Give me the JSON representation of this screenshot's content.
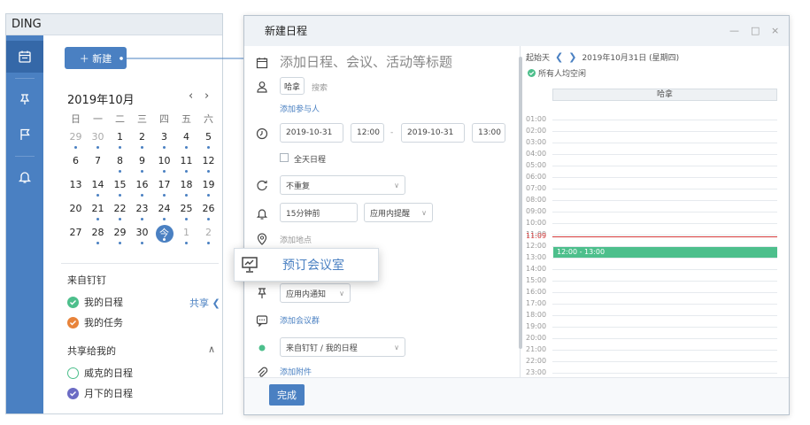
{
  "app": {
    "title": "DING",
    "new_button": "＋ 新建",
    "calendar": {
      "month_title": "2019年10月",
      "prev": "‹",
      "next": "›",
      "weekdays": [
        "日",
        "一",
        "二",
        "三",
        "四",
        "五",
        "六"
      ],
      "weeks": [
        [
          {
            "d": "29",
            "muted": true,
            "dot": true
          },
          {
            "d": "30",
            "muted": true,
            "dot": true
          },
          {
            "d": "1",
            "dot": true
          },
          {
            "d": "2",
            "dot": true
          },
          {
            "d": "3",
            "dot": true
          },
          {
            "d": "4",
            "dot": true
          },
          {
            "d": "5",
            "dot": true
          }
        ],
        [
          {
            "d": "6"
          },
          {
            "d": "7"
          },
          {
            "d": "8",
            "dot": true
          },
          {
            "d": "9",
            "dot": true
          },
          {
            "d": "10",
            "dot": true
          },
          {
            "d": "11",
            "dot": true
          },
          {
            "d": "12",
            "dot": true
          }
        ],
        [
          {
            "d": "13"
          },
          {
            "d": "14",
            "dot": true
          },
          {
            "d": "15",
            "dot": true
          },
          {
            "d": "16",
            "dot": true
          },
          {
            "d": "17",
            "dot": true
          },
          {
            "d": "18",
            "dot": true
          },
          {
            "d": "19",
            "dot": true
          }
        ],
        [
          {
            "d": "20"
          },
          {
            "d": "21",
            "dot": true
          },
          {
            "d": "22",
            "dot": true
          },
          {
            "d": "23",
            "dot": true
          },
          {
            "d": "24",
            "dot": true
          },
          {
            "d": "25",
            "dot": true
          },
          {
            "d": "26",
            "dot": true
          }
        ],
        [
          {
            "d": "27"
          },
          {
            "d": "28",
            "dot": true
          },
          {
            "d": "29",
            "dot": true
          },
          {
            "d": "30",
            "dot": true
          },
          {
            "d": "今",
            "today": true,
            "dot": true
          },
          {
            "d": "1",
            "muted": true,
            "dot": true
          },
          {
            "d": "2",
            "muted": true,
            "dot": true
          }
        ]
      ]
    },
    "from_dingtalk": "来自钉钉",
    "my_schedule": "我的日程",
    "my_tasks": "我的任务",
    "share": "共享",
    "shared_to_me": "共享给我的",
    "wake_schedule": "威克的日程",
    "yuexia_schedule": "月下的日程"
  },
  "dialog": {
    "title": "新建日程",
    "title_placeholder": "添加日程、会议、活动等标题",
    "participant_chip": "哈拿",
    "search": "搜索",
    "add_participant": "添加参与人",
    "start_date": "2019-10-31",
    "start_time": "12:00",
    "dash": "-",
    "end_date": "2019-10-31",
    "end_time": "13:00",
    "all_day": "全天日程",
    "repeat": "不重复",
    "reminder": "15分钟前",
    "reminder_type": "应用内提醒",
    "add_location": "添加地点",
    "book_room": "预订会议室",
    "notify": "应用内通知",
    "add_group": "添加会议群",
    "calendar_select": "来自钉钉 / 我的日程",
    "add_attachment": "添加附件",
    "done": "完成",
    "win_min": "—",
    "win_max": "□",
    "win_close": "×"
  },
  "schedule": {
    "start_label": "起始天",
    "date": "2019年10月31日 (星期四)",
    "all_free": "所有人均空闲",
    "person": "哈拿",
    "hours": [
      "01:00",
      "02:00",
      "03:00",
      "04:00",
      "05:00",
      "06:00",
      "07:00",
      "08:00",
      "09:00",
      "10:00",
      "11:00",
      "12:00",
      "13:00",
      "14:00",
      "15:00",
      "16:00",
      "17:00",
      "18:00",
      "19:00",
      "20:00",
      "21:00",
      "22:00",
      "23:00"
    ],
    "now": "11:09",
    "busy_block": "12:00 - 13:00"
  },
  "colors": {
    "accent": "#4a80c2",
    "rail": "#4a80c2",
    "green": "#4dbf8c",
    "orange": "#e8833a",
    "purple": "#6b6bc4",
    "now_red": "#d43a3a"
  }
}
